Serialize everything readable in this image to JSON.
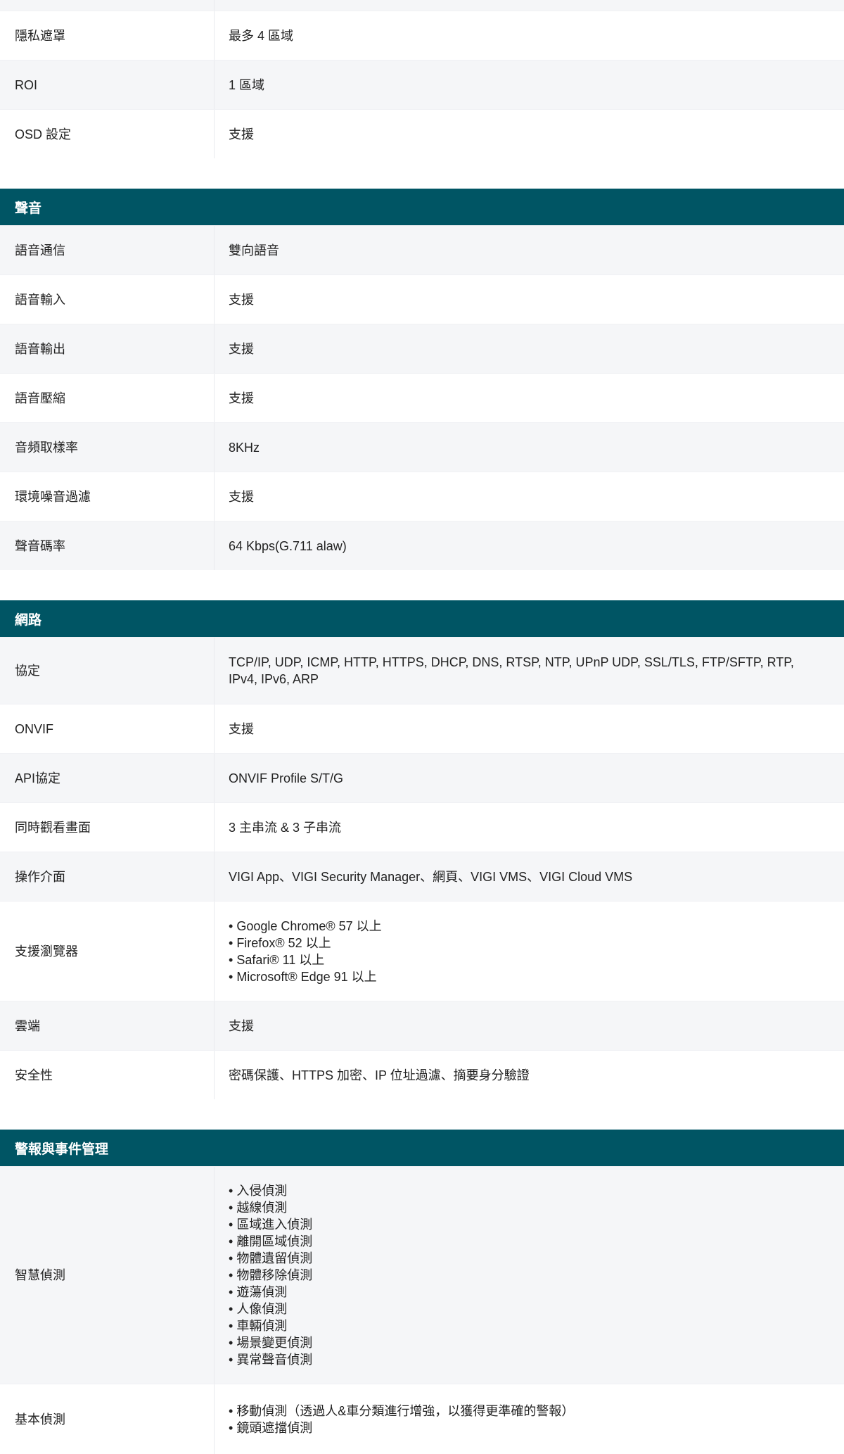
{
  "sections": [
    {
      "title": "",
      "rows": [
        {
          "label": "",
          "value": ""
        },
        {
          "label": "隱私遮罩",
          "value": "最多 4 區域"
        },
        {
          "label": "ROI",
          "value": "1 區域"
        },
        {
          "label": "OSD 設定",
          "value": "支援"
        }
      ]
    },
    {
      "title": "聲音",
      "rows": [
        {
          "label": "語音通信",
          "value": "雙向語音"
        },
        {
          "label": "語音輸入",
          "value": "支援"
        },
        {
          "label": "語音輸出",
          "value": "支援"
        },
        {
          "label": "語音壓縮",
          "value": "支援"
        },
        {
          "label": "音頻取樣率",
          "value": "8KHz"
        },
        {
          "label": "環境噪音過濾",
          "value": "支援"
        },
        {
          "label": "聲音碼率",
          "value": "64 Kbps(G.711 alaw)"
        }
      ]
    },
    {
      "title": "網路",
      "rows": [
        {
          "label": "協定",
          "value": "TCP/IP, UDP, ICMP, HTTP, HTTPS, DHCP, DNS, RTSP, NTP, UPnP UDP, SSL/TLS, FTP/SFTP, RTP, IPv4, IPv6, ARP"
        },
        {
          "label": "ONVIF",
          "value": "支援"
        },
        {
          "label": "API協定",
          "value": "ONVIF Profile S/T/G"
        },
        {
          "label": "同時觀看畫面",
          "value": "3 主串流 & 3 子串流"
        },
        {
          "label": "操作介面",
          "value": "VIGI App、VIGI Security Manager、網頁、VIGI VMS、VIGI Cloud VMS"
        },
        {
          "label": "支援瀏覽器",
          "items": [
            "Google Chrome® 57 以上",
            "Firefox® 52 以上",
            "Safari® 11 以上",
            "Microsoft® Edge 91 以上"
          ]
        },
        {
          "label": "雲端",
          "value": "支援"
        },
        {
          "label": "安全性",
          "value": "密碼保護、HTTPS 加密、IP 位址過濾、摘要身分驗證"
        }
      ]
    },
    {
      "title": "警報與事件管理",
      "rows": [
        {
          "label": "智慧偵測",
          "items": [
            "入侵偵測",
            "越線偵測",
            "區域進入偵測",
            "離開區域偵測",
            "物體遺留偵測",
            "物體移除偵測",
            "遊蕩偵測",
            "人像偵測",
            "車輛偵測",
            "場景變更偵測",
            "異常聲音偵測"
          ]
        },
        {
          "label": "基本偵測",
          "items": [
            "移動偵測（透過人&車分類進行增強，以獲得更準確的警報）",
            "鏡頭遮擋偵測"
          ]
        }
      ]
    }
  ]
}
